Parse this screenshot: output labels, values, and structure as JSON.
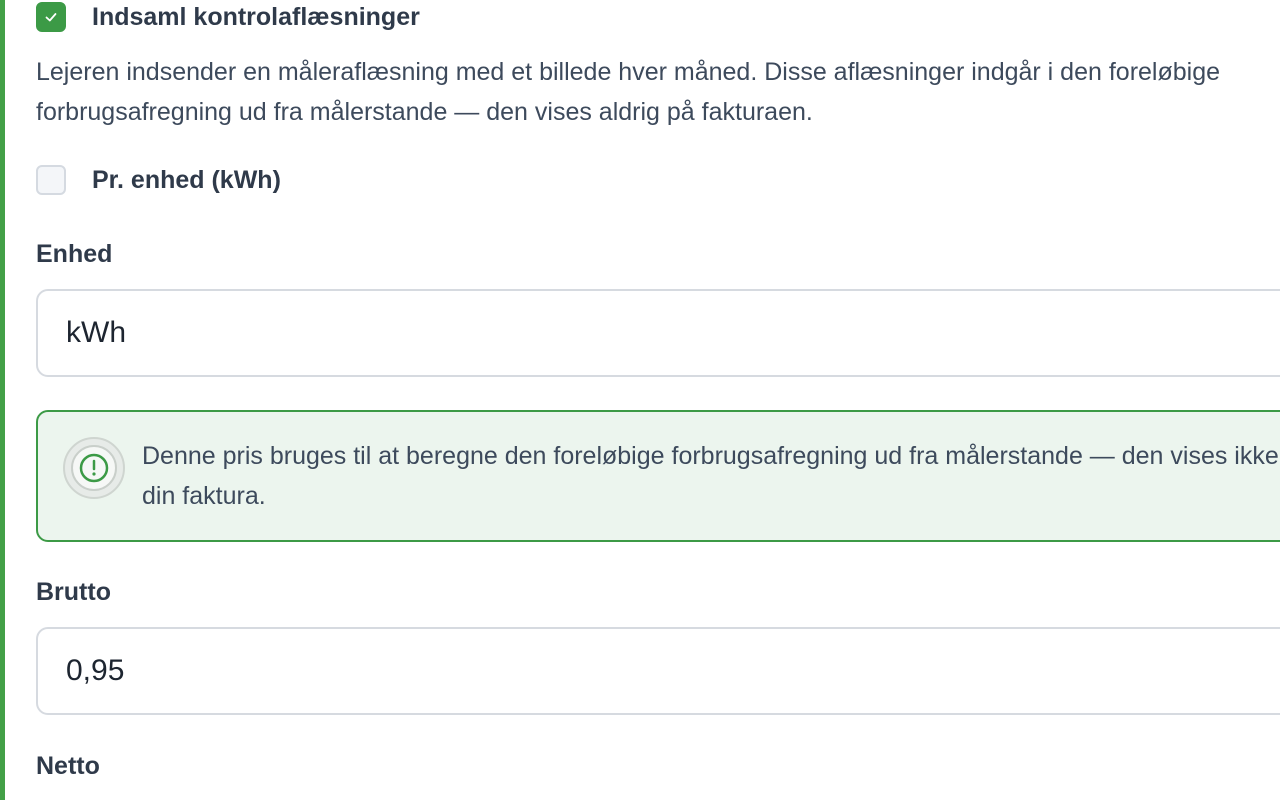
{
  "colors": {
    "accent": "#3c9a46",
    "info_background": "#ecf5ee",
    "text": "#2f3a4a"
  },
  "control_readings": {
    "checked": true,
    "label": "Indsaml kontrolaflæsninger",
    "description": "Lejeren indsender en måleraflæsning med et billede hver måned. Disse aflæsninger indgår i den foreløbige forbrugsafregning ud fra målerstande — den vises aldrig på fakturaen."
  },
  "per_unit": {
    "checked": false,
    "label": "Pr. enhed (kWh)"
  },
  "unit_field": {
    "label": "Enhed",
    "value": "kWh"
  },
  "info_notice": {
    "icon": "info-icon",
    "text": "Denne pris bruges til at beregne den foreløbige forbrugsafregning ud fra målerstande — den vises ikke på din faktura."
  },
  "gross_field": {
    "label": "Brutto",
    "value": "0,95"
  },
  "net_field": {
    "label": "Netto"
  }
}
